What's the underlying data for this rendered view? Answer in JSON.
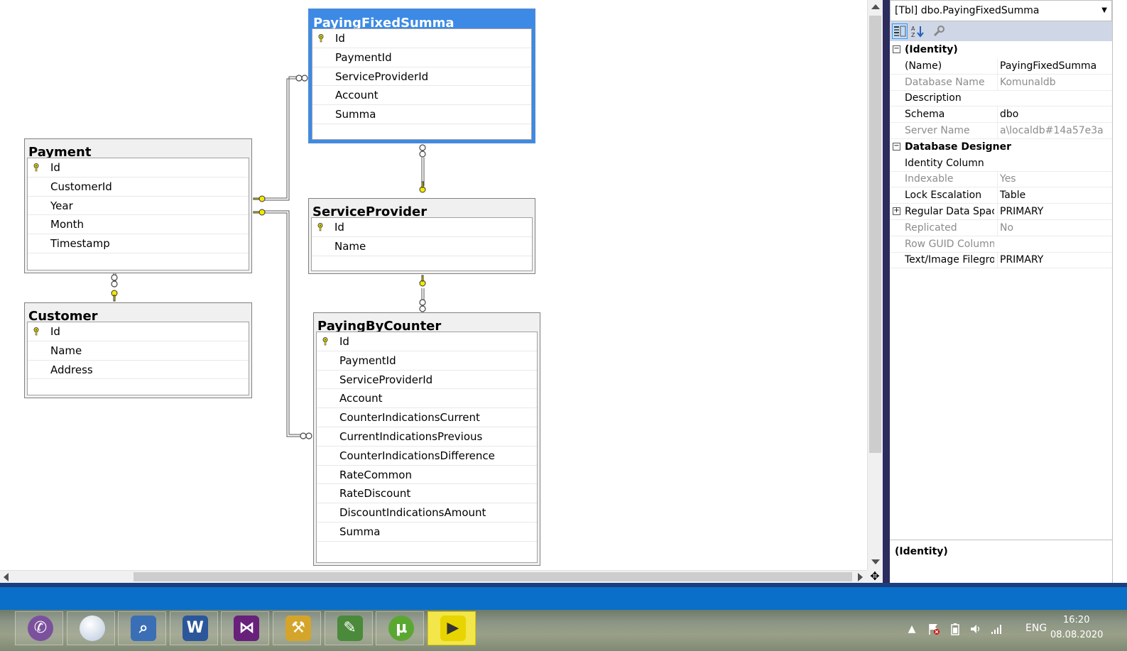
{
  "diagram": {
    "tables": {
      "paying_fixed_summa": {
        "title": "PayingFixedSumma",
        "columns": [
          {
            "name": "Id",
            "key": true
          },
          {
            "name": "PaymentId",
            "key": false
          },
          {
            "name": "ServiceProviderId",
            "key": false
          },
          {
            "name": "Account",
            "key": false
          },
          {
            "name": "Summa",
            "key": false
          }
        ]
      },
      "payment": {
        "title": "Payment",
        "columns": [
          {
            "name": "Id",
            "key": true
          },
          {
            "name": "CustomerId",
            "key": false
          },
          {
            "name": "Year",
            "key": false
          },
          {
            "name": "Month",
            "key": false
          },
          {
            "name": "Timestamp",
            "key": false
          }
        ]
      },
      "service_provider": {
        "title": "ServiceProvider",
        "columns": [
          {
            "name": "Id",
            "key": true
          },
          {
            "name": "Name",
            "key": false
          }
        ]
      },
      "customer": {
        "title": "Customer",
        "columns": [
          {
            "name": "Id",
            "key": true
          },
          {
            "name": "Name",
            "key": false
          },
          {
            "name": "Address",
            "key": false
          }
        ]
      },
      "paying_by_counter": {
        "title": "PayingByCounter",
        "columns": [
          {
            "name": "Id",
            "key": true
          },
          {
            "name": "PaymentId",
            "key": false
          },
          {
            "name": "ServiceProviderId",
            "key": false
          },
          {
            "name": "Account",
            "key": false
          },
          {
            "name": "CounterIndicationsCurrent",
            "key": false
          },
          {
            "name": "CurrentIndicationsPrevious",
            "key": false
          },
          {
            "name": "CounterIndicationsDifference",
            "key": false
          },
          {
            "name": "RateCommon",
            "key": false
          },
          {
            "name": "RateDiscount",
            "key": false
          },
          {
            "name": "DiscountIndicationsAmount",
            "key": false
          },
          {
            "name": "Summa",
            "key": false
          }
        ]
      }
    },
    "key_color": "#e8e000",
    "selection_color": "#3c8ae6"
  },
  "properties": {
    "object_label": "[Tbl] dbo.PayingFixedSumma",
    "toolbar": [
      "categorized-icon",
      "alphabetical-icon",
      "property-pages-icon"
    ],
    "categories": [
      {
        "label": "(Identity)",
        "expanded": true,
        "rows": [
          {
            "name": "(Name)",
            "value": "PayingFixedSumma",
            "readonly": false
          },
          {
            "name": "Database Name",
            "value": "Komunaldb",
            "readonly": true
          },
          {
            "name": "Description",
            "value": "",
            "readonly": false
          },
          {
            "name": "Schema",
            "value": "dbo",
            "readonly": false
          },
          {
            "name": "Server Name",
            "value": "a\\localdb#14a57e3a",
            "readonly": true
          }
        ]
      },
      {
        "label": "Database Designer",
        "expanded": true,
        "rows": [
          {
            "name": "Identity Column",
            "value": "",
            "readonly": false
          },
          {
            "name": "Indexable",
            "value": "Yes",
            "readonly": true
          },
          {
            "name": "Lock Escalation",
            "value": "Table",
            "readonly": false
          },
          {
            "name": "Regular Data Space",
            "value": "PRIMARY",
            "readonly": false,
            "expandable": true
          },
          {
            "name": "Replicated",
            "value": "No",
            "readonly": true
          },
          {
            "name": "Row GUID Column",
            "value": "",
            "readonly": true
          },
          {
            "name": "Text/Image Filegroup",
            "value": "PRIMARY",
            "readonly": false
          }
        ]
      }
    ],
    "description_title": "(Identity)"
  },
  "taskbar": {
    "apps": [
      {
        "name": "viber-icon",
        "color": "#7b519d"
      },
      {
        "name": "globe-icon",
        "color": "#b8c8dc"
      },
      {
        "name": "magnifier-icon",
        "color": "#3a6fb6"
      },
      {
        "name": "word-icon",
        "color": "#2b579a"
      },
      {
        "name": "visual-studio-icon",
        "color": "#68217a"
      },
      {
        "name": "sql-tools-icon",
        "color": "#d4a52a"
      },
      {
        "name": "notepad-icon",
        "color": "#4a8a3a"
      },
      {
        "name": "utorrent-icon",
        "color": "#5aa832"
      },
      {
        "name": "media-player-icon",
        "color": "#e8d400"
      }
    ],
    "tray": {
      "language": "ENG",
      "time": "16:20",
      "date": "08.08.2020"
    }
  }
}
